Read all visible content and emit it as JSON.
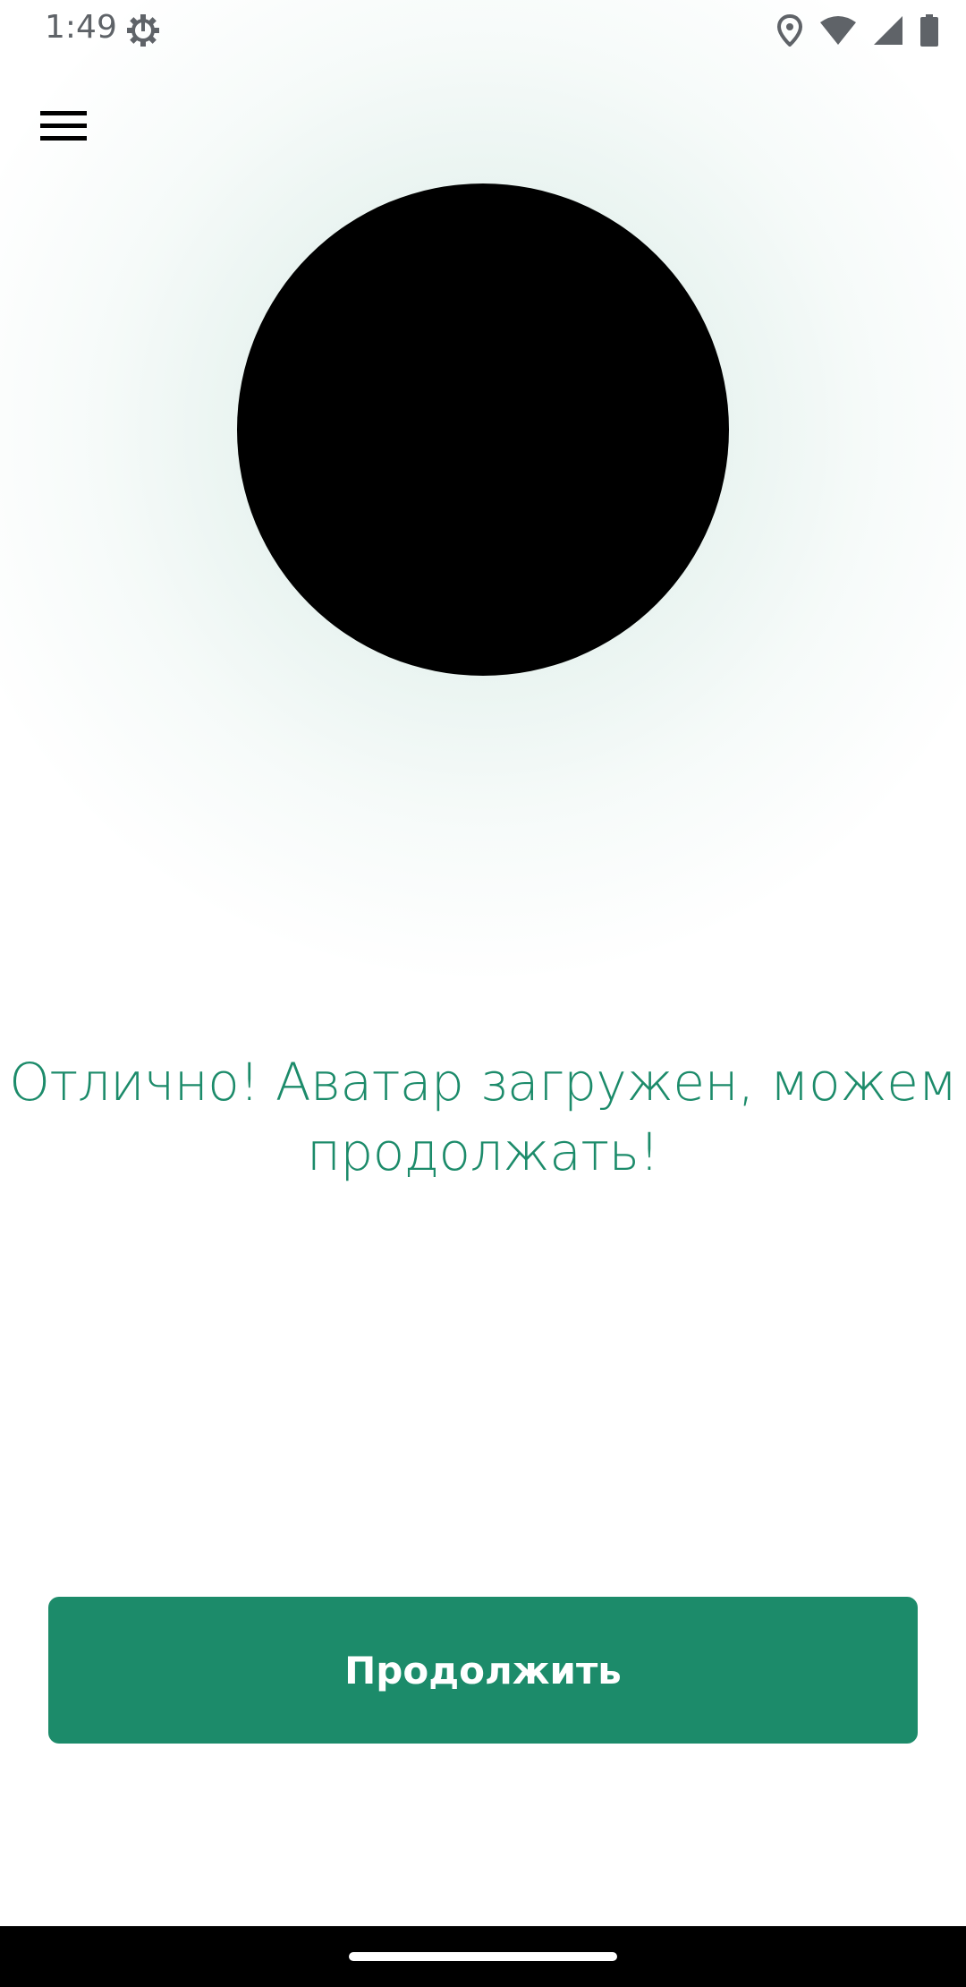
{
  "status_bar": {
    "time": "1:49",
    "icons": [
      "settings-gear-icon",
      "location-icon",
      "wifi-icon",
      "signal-icon",
      "battery-icon"
    ]
  },
  "header": {
    "menu_icon": "hamburger-menu-icon"
  },
  "avatar": {
    "fill_color": "#000000"
  },
  "message": {
    "line1": "Отлично! Аватар загружен, можем",
    "line2": "продолжать!"
  },
  "actions": {
    "continue_label": "Продолжить"
  },
  "colors": {
    "accent": "#1c8b6a",
    "background": "#ffffff",
    "nav_bar": "#000000"
  }
}
